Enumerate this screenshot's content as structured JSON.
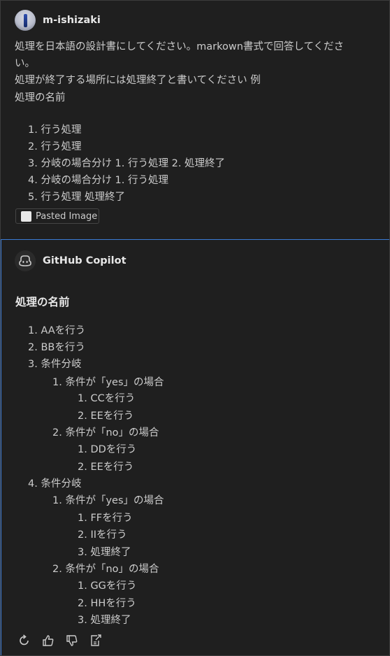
{
  "user": {
    "name": "m-ishizaki",
    "message_lines": [
      "処理を日本語の設計書にしてください。markown書式で回答してくださ",
      "い。",
      "処理が終了する場所には処理終了と書いてください 例",
      "処理の名前"
    ],
    "list": [
      "1. 行う処理",
      "2. 行う処理",
      "3. 分岐の場合分け 1. 行う処理 2. 処理終了",
      "4. 分岐の場合分け 1. 行う処理",
      "5. 行う処理 処理終了"
    ],
    "attachment_label": "Pasted Image"
  },
  "copilot": {
    "name": "GitHub Copilot",
    "heading": "処理の名前",
    "list": [
      "1. AAを行う",
      "2. BBを行う",
      "3. 条件分岐",
      "1. 条件が「yes」の場合",
      "1. CCを行う",
      "2. EEを行う",
      "2. 条件が「no」の場合",
      "1. DDを行う",
      "2. EEを行う",
      "4. 条件分岐",
      "1. 条件が「yes」の場合",
      "1. FFを行う",
      "2. IIを行う",
      "3. 処理終了",
      "2. 条件が「no」の場合",
      "1. GGを行う",
      "2. HHを行う",
      "3. 処理終了"
    ]
  },
  "actions": [
    "retry-icon",
    "thumbs-up-icon",
    "thumbs-down-icon",
    "insert-icon"
  ]
}
